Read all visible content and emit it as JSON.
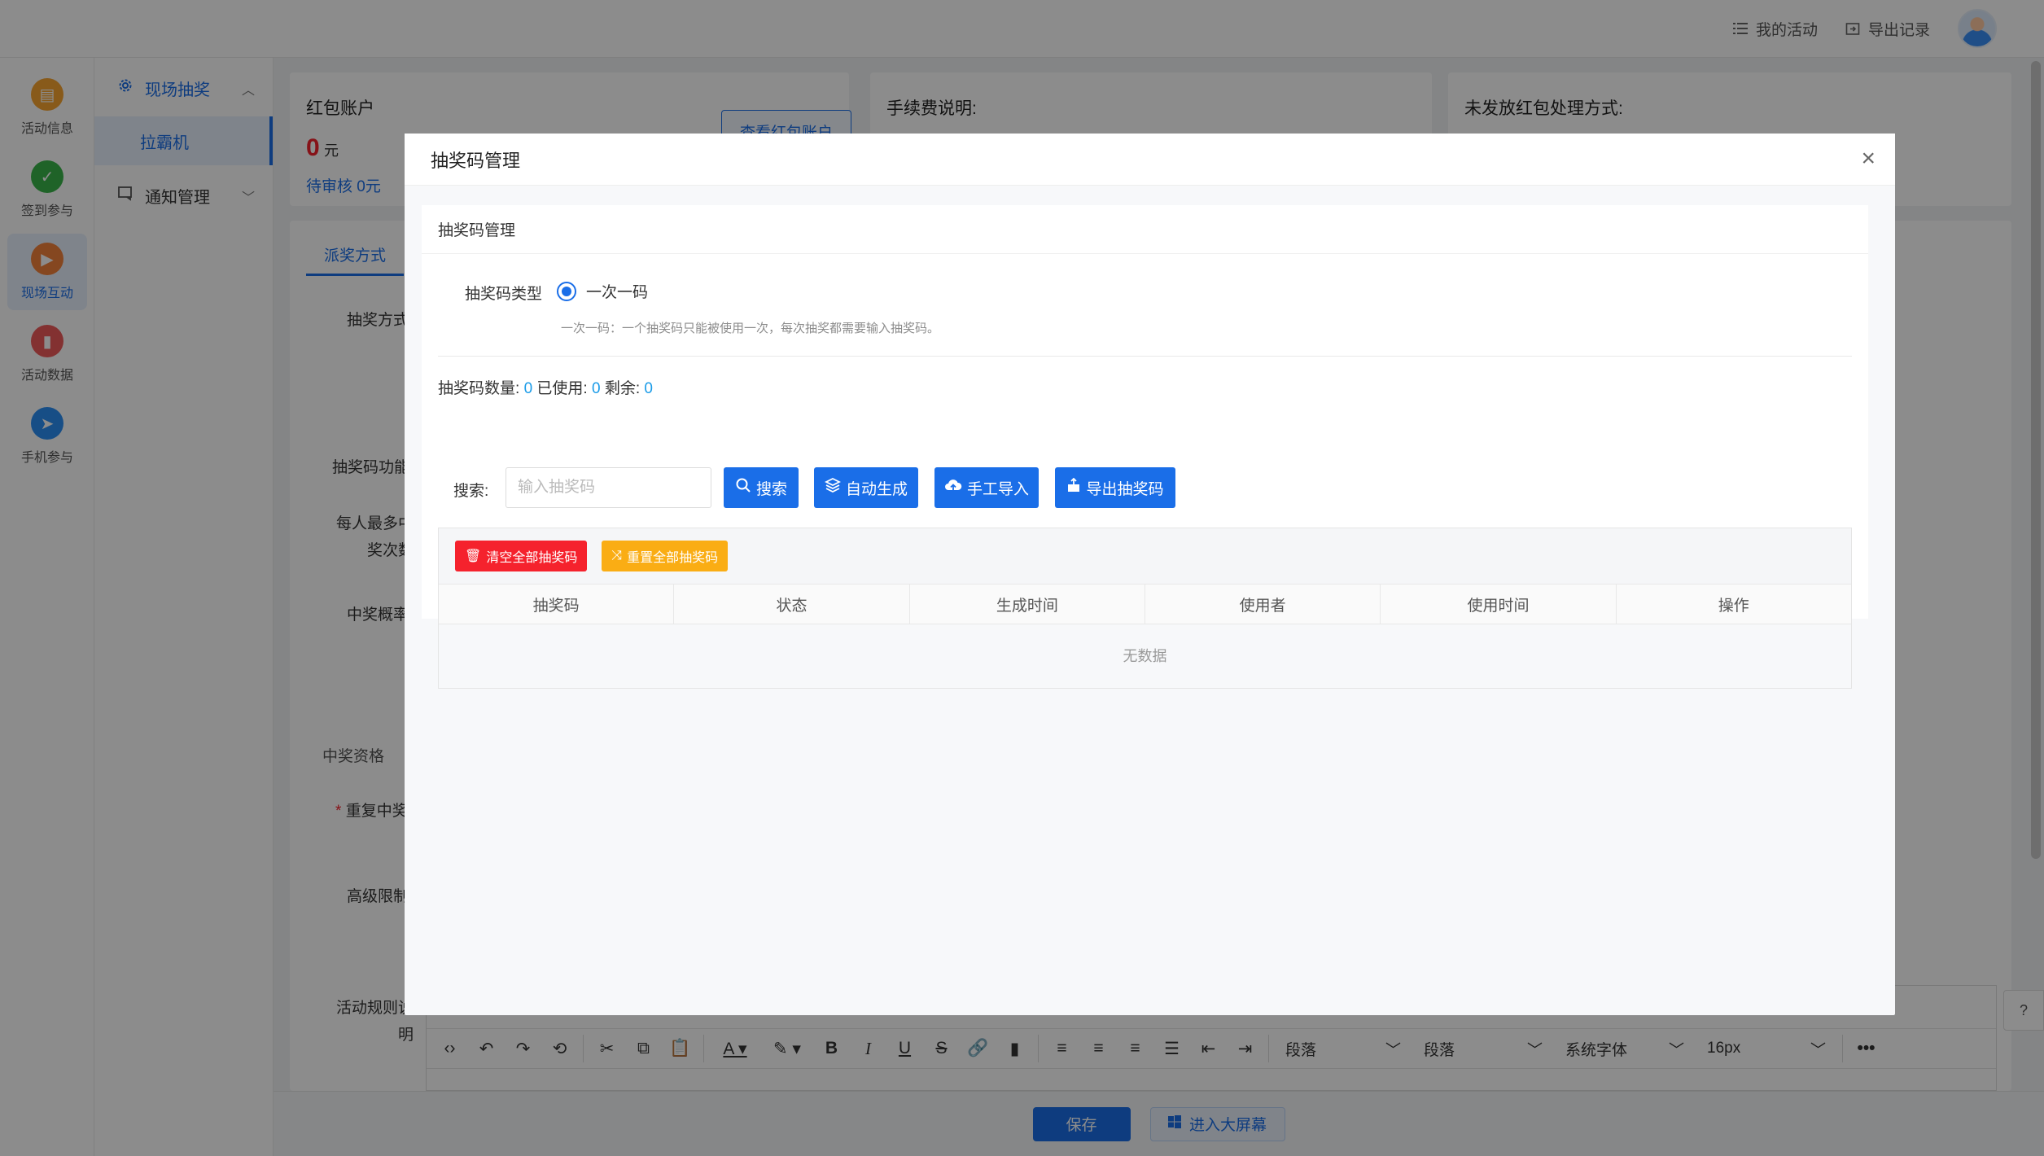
{
  "header": {
    "my_activities": "我的活动",
    "export_records": "导出记录"
  },
  "rail": [
    {
      "label": "活动信息",
      "icon": "activity-info-icon",
      "color": "#f7a531"
    },
    {
      "label": "签到参与",
      "icon": "checkin-icon",
      "color": "#3ab54a"
    },
    {
      "label": "现场互动",
      "icon": "live-interaction-icon",
      "color": "#f3823b"
    },
    {
      "label": "活动数据",
      "icon": "activity-data-icon",
      "color": "#ef5a5a"
    },
    {
      "label": "手机参与",
      "icon": "mobile-join-icon",
      "color": "#2a8ff5"
    }
  ],
  "submenu": {
    "group1": "现场抽奖",
    "item1": "拉霸机",
    "group2": "通知管理"
  },
  "account": {
    "title": "红包账户",
    "amount": "0",
    "unit": "元",
    "pending": "待审核 0元",
    "view_button": "查看红包账户"
  },
  "fee": {
    "title": "手续费说明:"
  },
  "unissued": {
    "title": "未发放红包处理方式:"
  },
  "form": {
    "tab": "派奖方式",
    "draw_method": "抽奖方式",
    "code_feature": "抽奖码功能",
    "max_wins_line1": "每人最多中",
    "max_wins_line2": "奖次数",
    "win_rate": "中奖概率",
    "qualification": "中奖资格",
    "repeat_win": "重复中奖",
    "advanced": "高级限制",
    "rules_line1": "活动规则说",
    "rules_line2": "明"
  },
  "editor": {
    "para1": "段落",
    "para2": "段落",
    "font": "系统字体",
    "size": "16px"
  },
  "bottom": {
    "save": "保存",
    "big_screen": "进入大屏幕"
  },
  "modal": {
    "title": "抽奖码管理",
    "inner_title": "抽奖码管理",
    "type_label": "抽奖码类型",
    "type_option": "一次一码",
    "type_hint": "一次一码：一个抽奖码只能被使用一次，每次抽奖都需要输入抽奖码。",
    "count_label": "抽奖码数量:",
    "count": "0",
    "used_label": "已使用:",
    "used": "0",
    "remain_label": "剩余:",
    "remain": "0",
    "search_label": "搜索:",
    "search_placeholder": "输入抽奖码",
    "btn_search": "搜索",
    "btn_auto": "自动生成",
    "btn_import": "手工导入",
    "btn_export": "导出抽奖码",
    "btn_clear": "清空全部抽奖码",
    "btn_reset": "重置全部抽奖码",
    "columns": [
      "抽奖码",
      "状态",
      "生成时间",
      "使用者",
      "使用时间",
      "操作"
    ],
    "empty": "无数据"
  },
  "colors": {
    "primary": "#1a6ee8",
    "danger": "#f5222d",
    "warning": "#faad14",
    "amount_red": "#f5222d"
  }
}
